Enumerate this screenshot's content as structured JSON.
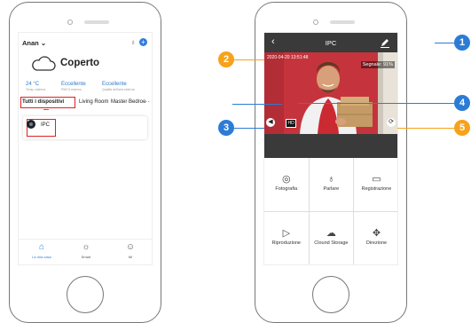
{
  "colors": {
    "accent": "#2f7de1",
    "highlight": "#e02020",
    "callout": "#f7a21b",
    "callout_blue": "#2c7cd6",
    "header_dark": "#3a3a3a"
  },
  "left_screen": {
    "user": "Anan",
    "user_chevron_icon": "chevron-down-icon",
    "mic_icon": "microphone-icon",
    "add_icon": "plus-icon",
    "add_label": "+",
    "weather": {
      "icon": "cloud-icon",
      "condition": "Coperto"
    },
    "metrics": [
      {
        "value": "24 °C",
        "sub": "Temp. esterna"
      },
      {
        "value": "Eccellente",
        "sub": "PM2.5 esterno"
      },
      {
        "value": "Eccellente",
        "sub": "Qualità dell'aria esterna"
      }
    ],
    "tabs": [
      "Tutti i dispositivi",
      "Living Room",
      "Master Bedroo"
    ],
    "more_label": "···",
    "device": {
      "name": "IPC",
      "icon": "camera-icon"
    },
    "bottom_nav": [
      {
        "label": "La mia casa",
        "icon": "home-icon",
        "glyph": "⌂",
        "active": true
      },
      {
        "label": "Smart",
        "icon": "sun-icon",
        "glyph": "☼",
        "active": false
      },
      {
        "label": "Mi",
        "icon": "user-icon",
        "glyph": "☺",
        "active": false
      }
    ]
  },
  "right_screen": {
    "back_label": "‹",
    "title": "IPC",
    "edit_icon": "pencil-icon",
    "timestamp": "2020-04-20 13:51:48",
    "signal": "Segnale: 91%",
    "hd_label": "HD",
    "volume_icon": "speaker-mute-icon",
    "volume_glyph": "◀",
    "rotate_icon": "rotate-icon",
    "rotate_glyph": "⟳",
    "actions": [
      {
        "label": "Fotografia",
        "icon": "camera-icon",
        "glyph": "◎"
      },
      {
        "label": "Parlare",
        "icon": "microphone-icon",
        "glyph": "♁"
      },
      {
        "label": "Registrazione",
        "icon": "video-record-icon",
        "glyph": "▭"
      },
      {
        "label": "Riproduzione",
        "icon": "play-circle-icon",
        "glyph": "▷"
      },
      {
        "label": "Clound Storage",
        "icon": "cloud-icon",
        "glyph": "☁"
      },
      {
        "label": "Direzione",
        "icon": "direction-arrows-icon",
        "glyph": "✥"
      }
    ]
  },
  "callouts": [
    "1",
    "2",
    "3",
    "4",
    "5"
  ]
}
